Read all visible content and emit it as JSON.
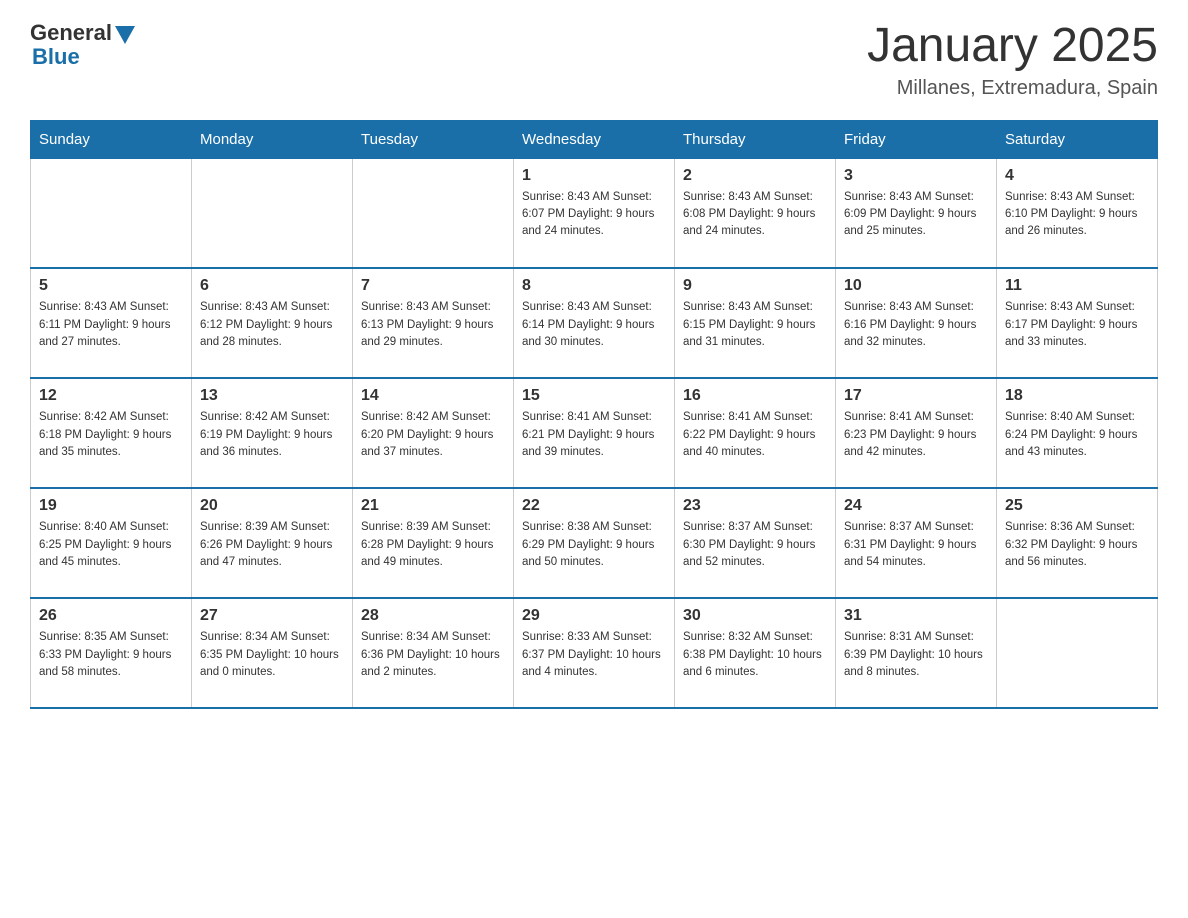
{
  "logo": {
    "general": "General",
    "blue": "Blue"
  },
  "title": "January 2025",
  "subtitle": "Millanes, Extremadura, Spain",
  "days_of_week": [
    "Sunday",
    "Monday",
    "Tuesday",
    "Wednesday",
    "Thursday",
    "Friday",
    "Saturday"
  ],
  "weeks": [
    [
      {
        "day": "",
        "info": ""
      },
      {
        "day": "",
        "info": ""
      },
      {
        "day": "",
        "info": ""
      },
      {
        "day": "1",
        "info": "Sunrise: 8:43 AM\nSunset: 6:07 PM\nDaylight: 9 hours\nand 24 minutes."
      },
      {
        "day": "2",
        "info": "Sunrise: 8:43 AM\nSunset: 6:08 PM\nDaylight: 9 hours\nand 24 minutes."
      },
      {
        "day": "3",
        "info": "Sunrise: 8:43 AM\nSunset: 6:09 PM\nDaylight: 9 hours\nand 25 minutes."
      },
      {
        "day": "4",
        "info": "Sunrise: 8:43 AM\nSunset: 6:10 PM\nDaylight: 9 hours\nand 26 minutes."
      }
    ],
    [
      {
        "day": "5",
        "info": "Sunrise: 8:43 AM\nSunset: 6:11 PM\nDaylight: 9 hours\nand 27 minutes."
      },
      {
        "day": "6",
        "info": "Sunrise: 8:43 AM\nSunset: 6:12 PM\nDaylight: 9 hours\nand 28 minutes."
      },
      {
        "day": "7",
        "info": "Sunrise: 8:43 AM\nSunset: 6:13 PM\nDaylight: 9 hours\nand 29 minutes."
      },
      {
        "day": "8",
        "info": "Sunrise: 8:43 AM\nSunset: 6:14 PM\nDaylight: 9 hours\nand 30 minutes."
      },
      {
        "day": "9",
        "info": "Sunrise: 8:43 AM\nSunset: 6:15 PM\nDaylight: 9 hours\nand 31 minutes."
      },
      {
        "day": "10",
        "info": "Sunrise: 8:43 AM\nSunset: 6:16 PM\nDaylight: 9 hours\nand 32 minutes."
      },
      {
        "day": "11",
        "info": "Sunrise: 8:43 AM\nSunset: 6:17 PM\nDaylight: 9 hours\nand 33 minutes."
      }
    ],
    [
      {
        "day": "12",
        "info": "Sunrise: 8:42 AM\nSunset: 6:18 PM\nDaylight: 9 hours\nand 35 minutes."
      },
      {
        "day": "13",
        "info": "Sunrise: 8:42 AM\nSunset: 6:19 PM\nDaylight: 9 hours\nand 36 minutes."
      },
      {
        "day": "14",
        "info": "Sunrise: 8:42 AM\nSunset: 6:20 PM\nDaylight: 9 hours\nand 37 minutes."
      },
      {
        "day": "15",
        "info": "Sunrise: 8:41 AM\nSunset: 6:21 PM\nDaylight: 9 hours\nand 39 minutes."
      },
      {
        "day": "16",
        "info": "Sunrise: 8:41 AM\nSunset: 6:22 PM\nDaylight: 9 hours\nand 40 minutes."
      },
      {
        "day": "17",
        "info": "Sunrise: 8:41 AM\nSunset: 6:23 PM\nDaylight: 9 hours\nand 42 minutes."
      },
      {
        "day": "18",
        "info": "Sunrise: 8:40 AM\nSunset: 6:24 PM\nDaylight: 9 hours\nand 43 minutes."
      }
    ],
    [
      {
        "day": "19",
        "info": "Sunrise: 8:40 AM\nSunset: 6:25 PM\nDaylight: 9 hours\nand 45 minutes."
      },
      {
        "day": "20",
        "info": "Sunrise: 8:39 AM\nSunset: 6:26 PM\nDaylight: 9 hours\nand 47 minutes."
      },
      {
        "day": "21",
        "info": "Sunrise: 8:39 AM\nSunset: 6:28 PM\nDaylight: 9 hours\nand 49 minutes."
      },
      {
        "day": "22",
        "info": "Sunrise: 8:38 AM\nSunset: 6:29 PM\nDaylight: 9 hours\nand 50 minutes."
      },
      {
        "day": "23",
        "info": "Sunrise: 8:37 AM\nSunset: 6:30 PM\nDaylight: 9 hours\nand 52 minutes."
      },
      {
        "day": "24",
        "info": "Sunrise: 8:37 AM\nSunset: 6:31 PM\nDaylight: 9 hours\nand 54 minutes."
      },
      {
        "day": "25",
        "info": "Sunrise: 8:36 AM\nSunset: 6:32 PM\nDaylight: 9 hours\nand 56 minutes."
      }
    ],
    [
      {
        "day": "26",
        "info": "Sunrise: 8:35 AM\nSunset: 6:33 PM\nDaylight: 9 hours\nand 58 minutes."
      },
      {
        "day": "27",
        "info": "Sunrise: 8:34 AM\nSunset: 6:35 PM\nDaylight: 10 hours\nand 0 minutes."
      },
      {
        "day": "28",
        "info": "Sunrise: 8:34 AM\nSunset: 6:36 PM\nDaylight: 10 hours\nand 2 minutes."
      },
      {
        "day": "29",
        "info": "Sunrise: 8:33 AM\nSunset: 6:37 PM\nDaylight: 10 hours\nand 4 minutes."
      },
      {
        "day": "30",
        "info": "Sunrise: 8:32 AM\nSunset: 6:38 PM\nDaylight: 10 hours\nand 6 minutes."
      },
      {
        "day": "31",
        "info": "Sunrise: 8:31 AM\nSunset: 6:39 PM\nDaylight: 10 hours\nand 8 minutes."
      },
      {
        "day": "",
        "info": ""
      }
    ]
  ]
}
